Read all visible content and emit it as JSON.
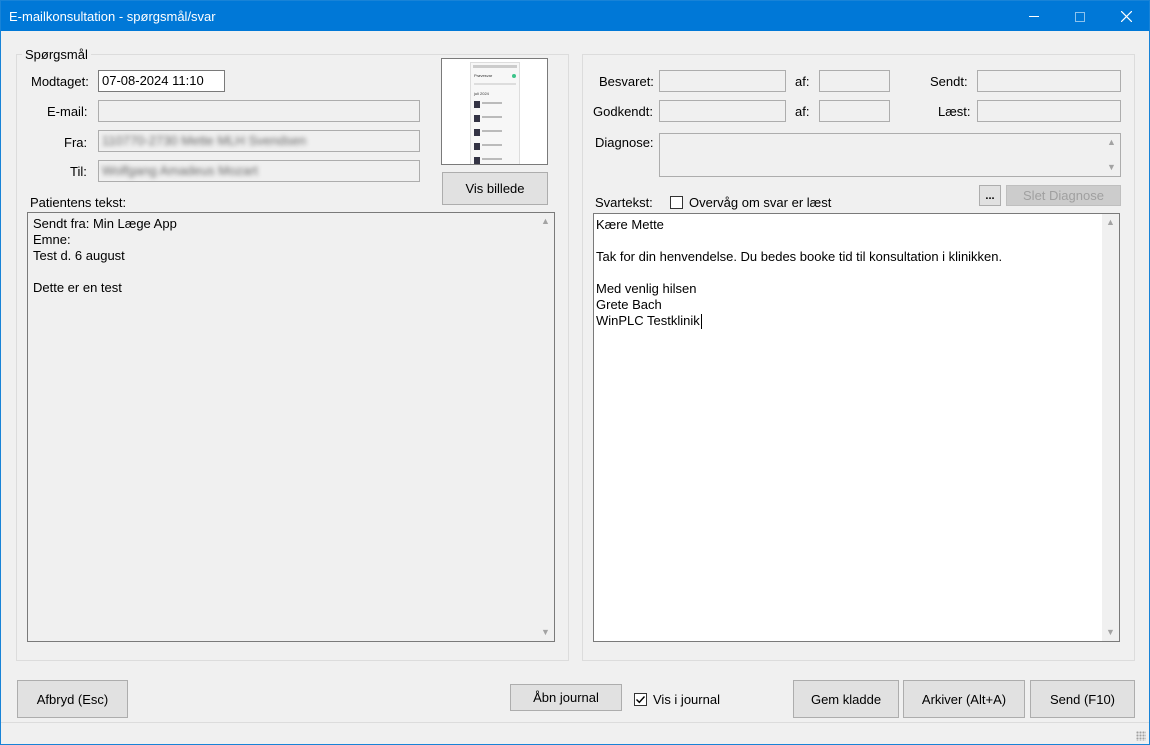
{
  "window": {
    "title": "E-mailkonsultation - spørgsmål/svar"
  },
  "question": {
    "group_title": "Spørgsmål",
    "received_label": "Modtaget:",
    "received_value": "07-08-2024 11:10",
    "email_label": "E-mail:",
    "email_value": "",
    "from_label": "Fra:",
    "from_value": "110770-2730 Mette MLH Svendsen",
    "to_label": "Til:",
    "to_value": "Wolfgang Amadeus Mozart",
    "show_image_label": "Vis billede",
    "patient_text_label": "Patientens tekst:",
    "patient_text_lines": [
      "Sendt fra: Min Læge App",
      "Emne:",
      "Test d. 6 august",
      "",
      "Dette er en test"
    ]
  },
  "answer": {
    "answered_label": "Besvaret:",
    "approved_label": "Godkendt:",
    "by_label_1": "af:",
    "by_label_2": "af:",
    "sent_label": "Sendt:",
    "read_label": "Læst:",
    "diagnosis_label": "Diagnose:",
    "reply_label": "Svartekst:",
    "monitor_label": "Overvåg om svar er læst",
    "monitor_checked": false,
    "more_label": "...",
    "delete_diagnosis_label": "Slet Diagnose",
    "reply_lines": [
      "Kære Mette",
      "",
      "Tak for din henvendelse. Du bedes booke tid til konsultation i klinikken.",
      "",
      "Med venlig hilsen",
      "Grete Bach",
      "WinPLC Testklinik"
    ]
  },
  "footer": {
    "cancel_label": "Afbryd (Esc)",
    "open_journal_label": "Åbn journal",
    "show_in_journal_label": "Vis i journal",
    "show_in_journal_checked": true,
    "save_draft_label": "Gem kladde",
    "archive_label": "Arkiver (Alt+A)",
    "send_label": "Send (F10)"
  },
  "thumbnail": {
    "heading": "Prøvesvar",
    "date": "juli 2024"
  }
}
